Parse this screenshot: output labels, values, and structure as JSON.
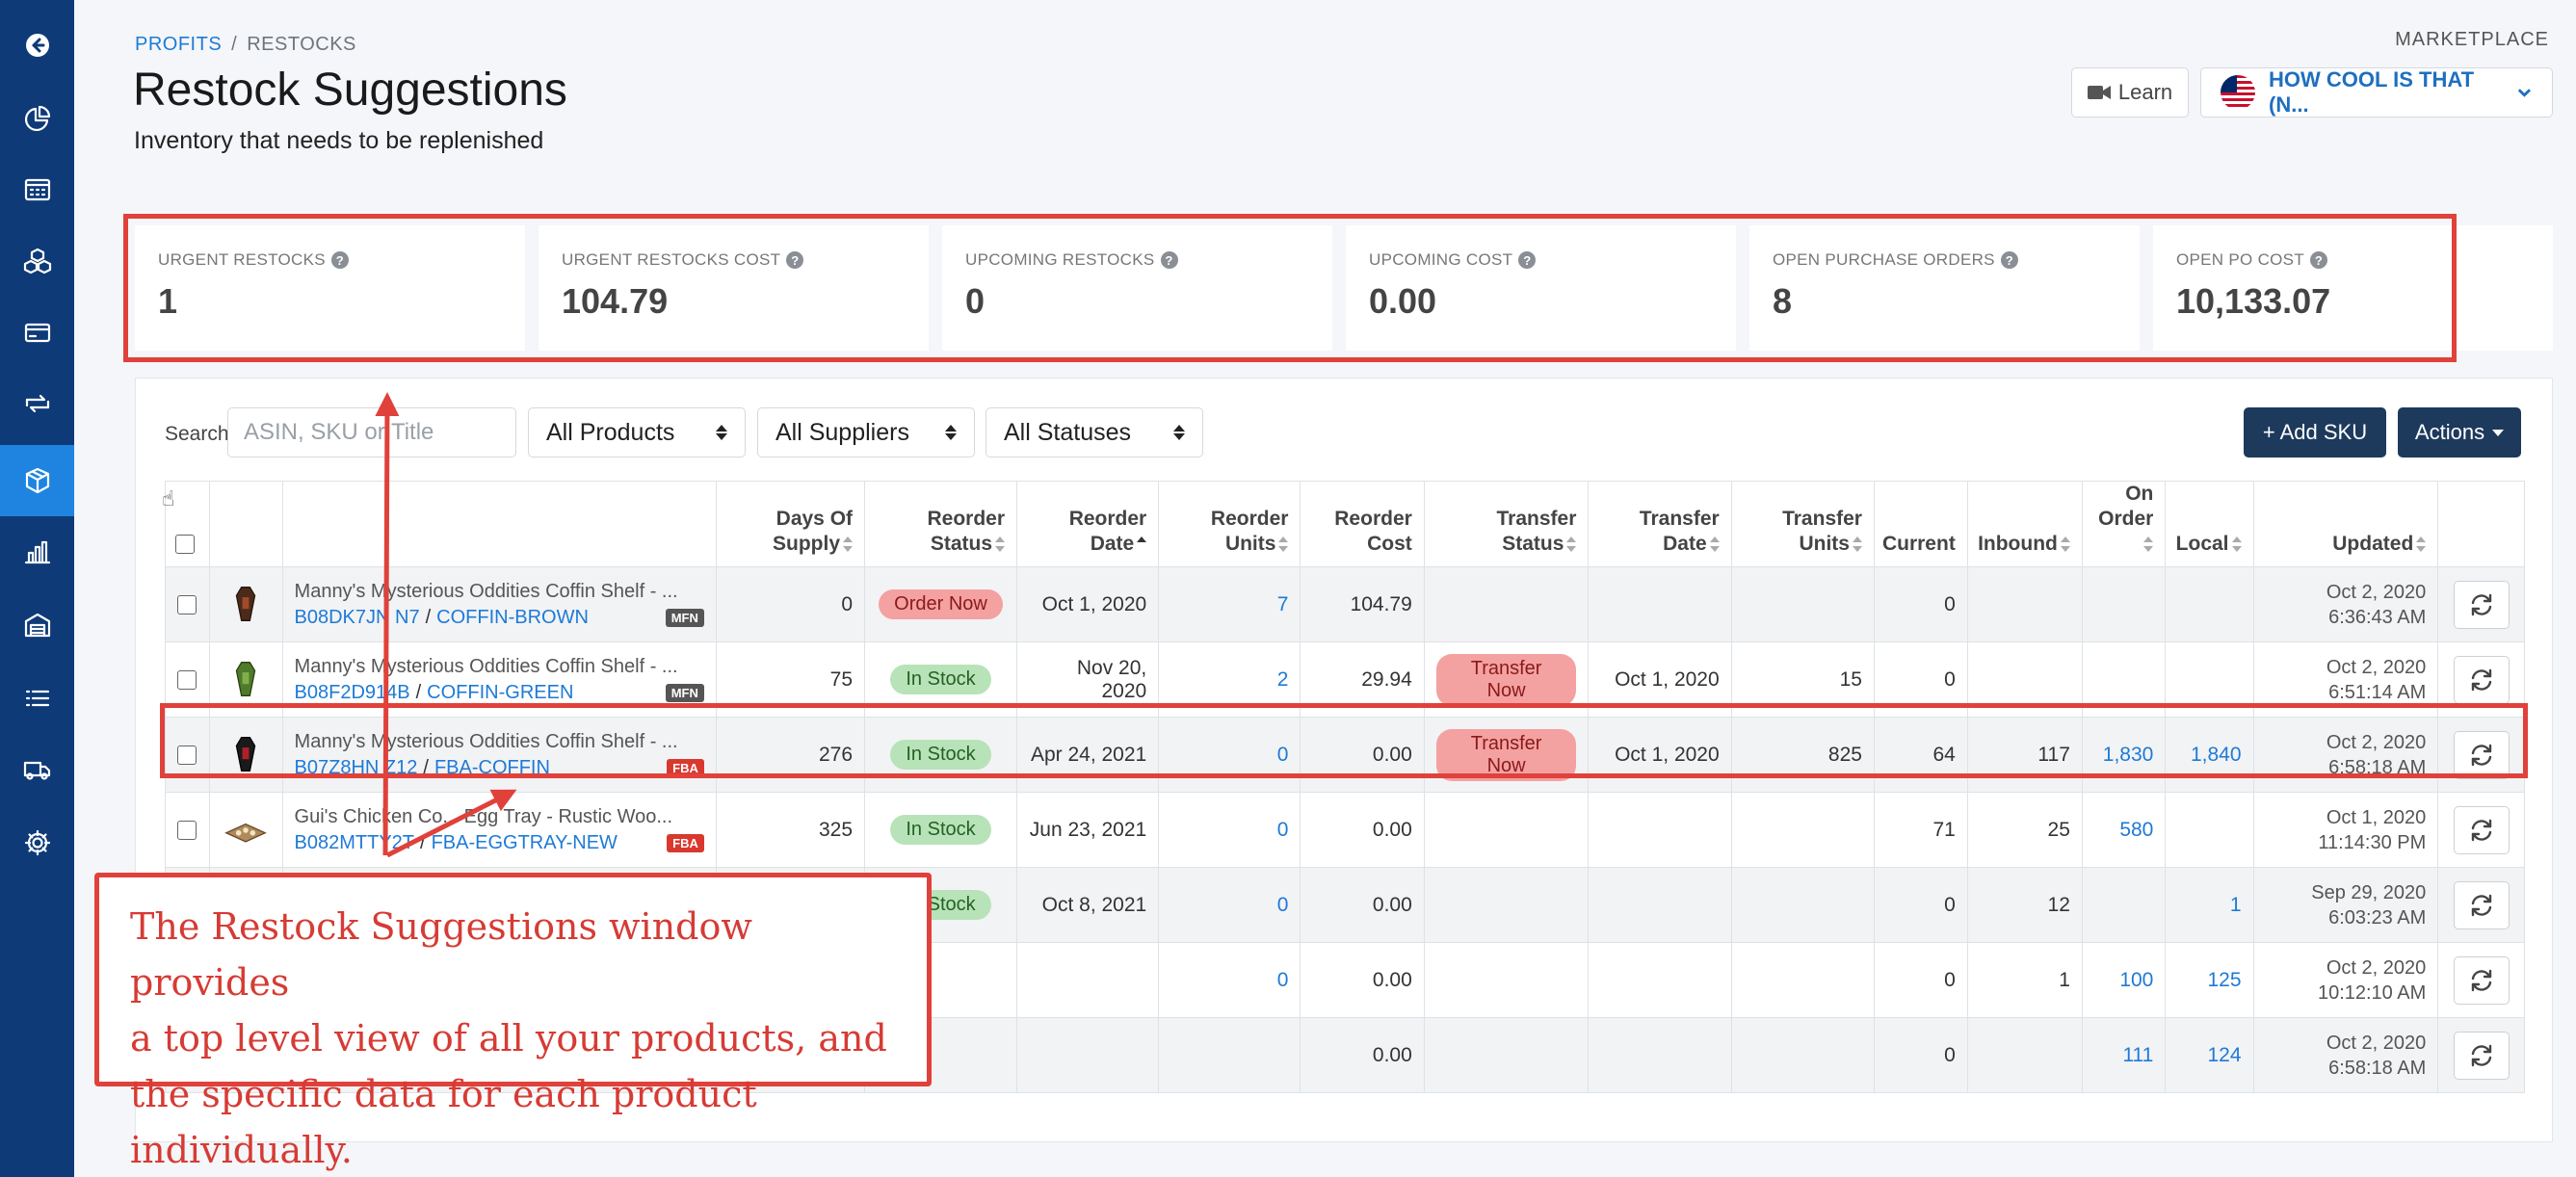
{
  "sidebar": {
    "items": [
      {
        "icon": "back-arrow-icon"
      },
      {
        "icon": "pie-chart-icon"
      },
      {
        "icon": "calculator-icon"
      },
      {
        "icon": "boxes-icon"
      },
      {
        "icon": "credit-card-icon"
      },
      {
        "icon": "repeat-icon"
      },
      {
        "icon": "box-icon",
        "active": true
      },
      {
        "icon": "bar-chart-icon"
      },
      {
        "icon": "warehouse-icon"
      },
      {
        "icon": "list-icon"
      },
      {
        "icon": "truck-icon"
      },
      {
        "icon": "settings-gear-icon"
      }
    ]
  },
  "breadcrumb": {
    "parent": "PROFITS",
    "separator": "/",
    "current": "RESTOCKS"
  },
  "header": {
    "title": "Restock Suggestions",
    "subtitle": "Inventory that needs to be replenished",
    "marketplace_label": "MARKETPLACE",
    "learn_label": "Learn",
    "marketplace_value": "HOW COOL IS THAT (N..."
  },
  "stats": [
    {
      "label": "URGENT RESTOCKS",
      "value": "1"
    },
    {
      "label": "URGENT RESTOCKS COST",
      "value": "104.79"
    },
    {
      "label": "UPCOMING RESTOCKS",
      "value": "0"
    },
    {
      "label": "UPCOMING COST",
      "value": "0.00"
    },
    {
      "label": "OPEN PURCHASE ORDERS",
      "value": "8"
    },
    {
      "label": "OPEN PO COST",
      "value": "10,133.07"
    }
  ],
  "toolbar": {
    "search_label": "Search",
    "search_placeholder": "ASIN, SKU or Title",
    "filter_products": "All Products",
    "filter_suppliers": "All Suppliers",
    "filter_statuses": "All Statuses",
    "add_sku_label": "+ Add SKU",
    "actions_label": "Actions"
  },
  "table": {
    "headers": {
      "days_of_supply": [
        "Days Of",
        "Supply"
      ],
      "reorder_status": [
        "Reorder",
        "Status"
      ],
      "reorder_date": [
        "Reorder",
        "Date"
      ],
      "reorder_units": [
        "Reorder",
        "Units"
      ],
      "reorder_cost": [
        "Reorder",
        "Cost"
      ],
      "transfer_status": [
        "Transfer",
        "Status"
      ],
      "transfer_date": [
        "Transfer",
        "Date"
      ],
      "transfer_units": [
        "Transfer",
        "Units"
      ],
      "current": "Current",
      "inbound": "Inbound",
      "on_order": [
        "On",
        "Order"
      ],
      "local": "Local",
      "updated": "Updated"
    },
    "rows": [
      {
        "title": "Manny's Mysterious Oddities Coffin Shelf - ...",
        "asin": "B08DK7JN N7",
        "sku": "COFFIN-BROWN",
        "tag": "MFN",
        "days": "0",
        "reorder_status": "Order Now",
        "reorder_status_color": "red",
        "reorder_date": "Oct 1, 2020",
        "reorder_units": "7",
        "reorder_cost": "104.79",
        "transfer_status": "",
        "transfer_date": "",
        "transfer_units": "",
        "current": "0",
        "inbound": "",
        "on_order": "",
        "local": "",
        "updated_date": "Oct 2, 2020",
        "updated_time": "6:36:43 AM"
      },
      {
        "title": "Manny's Mysterious Oddities Coffin Shelf - ...",
        "asin": "B08F2D914B",
        "sku": "COFFIN-GREEN",
        "tag": "MFN",
        "days": "75",
        "reorder_status": "In Stock",
        "reorder_status_color": "green",
        "reorder_date": "Nov 20, 2020",
        "reorder_units": "2",
        "reorder_cost": "29.94",
        "transfer_status": "Transfer Now",
        "transfer_date": "Oct 1, 2020",
        "transfer_units": "15",
        "current": "0",
        "inbound": "",
        "on_order": "",
        "local": "",
        "updated_date": "Oct 2, 2020",
        "updated_time": "6:51:14 AM"
      },
      {
        "title": "Manny's Mysterious Oddities Coffin Shelf - ...",
        "asin": "B07Z8HN Z12",
        "sku": "FBA-COFFIN",
        "tag": "FBA",
        "days": "276",
        "reorder_status": "In Stock",
        "reorder_status_color": "green",
        "reorder_date": "Apr 24, 2021",
        "reorder_units": "0",
        "reorder_cost": "0.00",
        "transfer_status": "Transfer Now",
        "transfer_date": "Oct 1, 2020",
        "transfer_units": "825",
        "current": "64",
        "inbound": "117",
        "on_order": "1,830",
        "local": "1,840",
        "updated_date": "Oct 2, 2020",
        "updated_time": "6:58:18 AM"
      },
      {
        "title": "Gui's Chicken Co... Egg Tray - Rustic Woo...",
        "asin": "B082MTTY2T",
        "sku": "FBA-EGGTRAY-NEW",
        "tag": "FBA",
        "days": "325",
        "reorder_status": "In Stock",
        "reorder_status_color": "green",
        "reorder_date": "Jun 23, 2021",
        "reorder_units": "0",
        "reorder_cost": "0.00",
        "transfer_status": "",
        "transfer_date": "",
        "transfer_units": "",
        "current": "71",
        "inbound": "25",
        "on_order": "580",
        "local": "",
        "updated_date": "Oct 1, 2020",
        "updated_time": "11:14:30 PM"
      },
      {
        "title": "",
        "asin": "",
        "sku": "",
        "tag": "",
        "days": "",
        "reorder_status": "In Stock",
        "reorder_status_color": "green",
        "reorder_date": "Oct 8, 2021",
        "reorder_units": "0",
        "reorder_cost": "0.00",
        "transfer_status": "",
        "transfer_date": "",
        "transfer_units": "",
        "current": "0",
        "inbound": "12",
        "on_order": "",
        "local": "1",
        "updated_date": "Sep 29, 2020",
        "updated_time": "6:03:23 AM"
      },
      {
        "title": "",
        "asin": "",
        "sku": "",
        "tag": "",
        "days": "",
        "reorder_status": "",
        "reorder_status_color": "",
        "reorder_date": "",
        "reorder_units": "0",
        "reorder_cost": "0.00",
        "transfer_status": "",
        "transfer_date": "",
        "transfer_units": "",
        "current": "0",
        "inbound": "1",
        "on_order": "100",
        "local": "125",
        "updated_date": "Oct 2, 2020",
        "updated_time": "10:12:10 AM"
      },
      {
        "title": "",
        "asin": "",
        "sku": "",
        "tag": "",
        "days": "",
        "reorder_status": "",
        "reorder_status_color": "",
        "reorder_date": "",
        "reorder_units": "",
        "reorder_cost": "0.00",
        "transfer_status": "",
        "transfer_date": "",
        "transfer_units": "",
        "current": "0",
        "inbound": "",
        "on_order": "111",
        "local": "124",
        "updated_date": "Oct 2, 2020",
        "updated_time": "6:58:18 AM"
      }
    ]
  },
  "annotation": {
    "lines": [
      "The Restock Suggestions window provides",
      "a top level view of all your products, and",
      "the specific data for each product individually."
    ],
    "color": "#e0413a"
  }
}
